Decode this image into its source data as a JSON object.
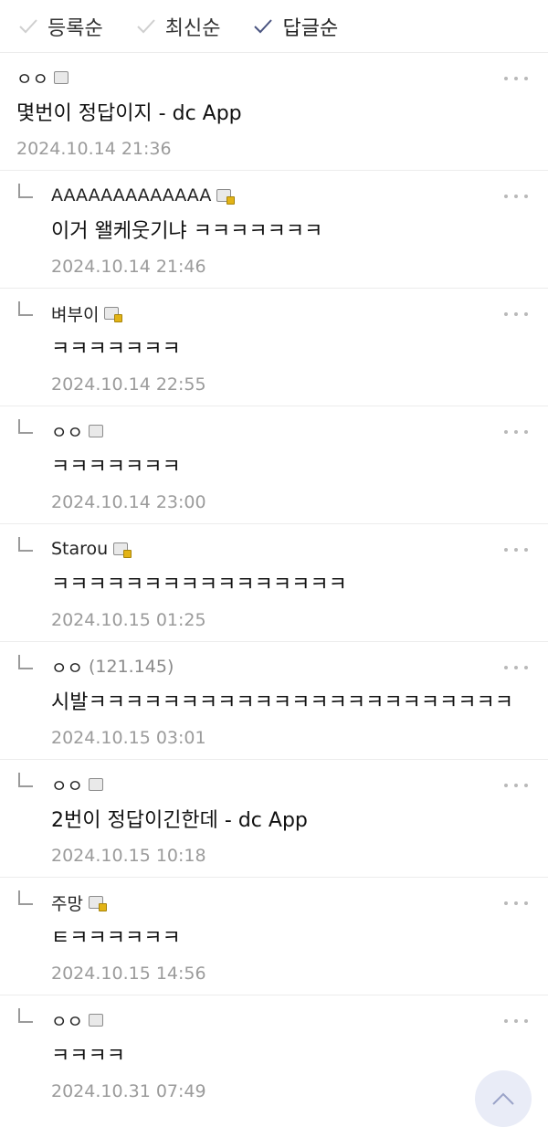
{
  "sort": {
    "options": [
      {
        "label": "등록순",
        "active": false
      },
      {
        "label": "최신순",
        "active": false
      },
      {
        "label": "답글순",
        "active": true
      }
    ]
  },
  "comments": [
    {
      "author": "ㅇㅇ",
      "icon": "user-icon",
      "content": "몇번이 정답이지 - dc App",
      "date": "2024.10.14 21:36",
      "reply": false
    },
    {
      "author": "AAAAAAAAAAAAA",
      "icon": "gold-user-icon",
      "content": "이거 왤케웃기냐 ㅋㅋㅋㅋㅋㅋㅋ",
      "date": "2024.10.14 21:46",
      "reply": true
    },
    {
      "author": "벼부이",
      "icon": "gold-user-icon",
      "content": "ㅋㅋㅋㅋㅋㅋㅋ",
      "date": "2024.10.14 22:55",
      "reply": true
    },
    {
      "author": "ㅇㅇ",
      "icon": "user-icon",
      "content": "ㅋㅋㅋㅋㅋㅋㅋ",
      "date": "2024.10.14 23:00",
      "reply": true
    },
    {
      "author": "Starou",
      "icon": "gold-user-icon",
      "content": "ㅋㅋㅋㅋㅋㅋㅋㅋㅋㅋㅋㅋㅋㅋㅋㅋ",
      "date": "2024.10.15 01:25",
      "reply": true
    },
    {
      "author": "ㅇㅇ",
      "ip": "(121.145)",
      "content": "시발ㅋㅋㅋㅋㅋㅋㅋㅋㅋㅋㅋㅋㅋㅋㅋㅋㅋㅋㅋㅋㅋㅋㅋ",
      "date": "2024.10.15 03:01",
      "reply": true
    },
    {
      "author": "ㅇㅇ",
      "icon": "user-icon",
      "content": "2번이 정답이긴한데 - dc App",
      "date": "2024.10.15 10:18",
      "reply": true
    },
    {
      "author": "주망",
      "icon": "gold-user-icon",
      "content": "ㅌㅋㅋㅋㅋㅋㅋ",
      "date": "2024.10.15 14:56",
      "reply": true
    },
    {
      "author": "ㅇㅇ",
      "icon": "user-icon",
      "content": "ㅋㅋㅋㅋ",
      "date": "2024.10.31 07:49",
      "reply": true
    }
  ],
  "colors": {
    "accent": "#4a5480",
    "date": "#9b9b9b",
    "badge": "#e2b316"
  }
}
